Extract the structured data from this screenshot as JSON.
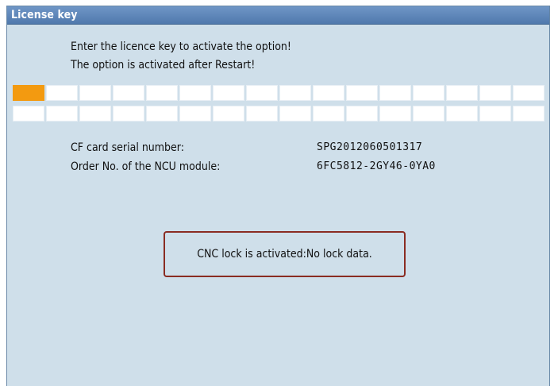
{
  "window": {
    "title": "License key"
  },
  "instructions": {
    "line1": "Enter the licence key to activate the option!",
    "line2": "The option is activated after Restart!"
  },
  "license_key_input": {
    "rows": 2,
    "cells_per_row": 16,
    "active_cell": 0
  },
  "info": {
    "cf_card_label": "CF card serial number:",
    "cf_card_value": "SPG2012060501317",
    "ncu_label": "Order No. of the NCU module:",
    "ncu_value": "6FC5812-2GY46-0YA0"
  },
  "message": {
    "text": "CNC lock is activated:No lock data."
  },
  "colors": {
    "title_bar": "#5a82b6",
    "background": "#cfdfea",
    "active_cell": "#f39a10",
    "message_border": "#8a2c22"
  }
}
